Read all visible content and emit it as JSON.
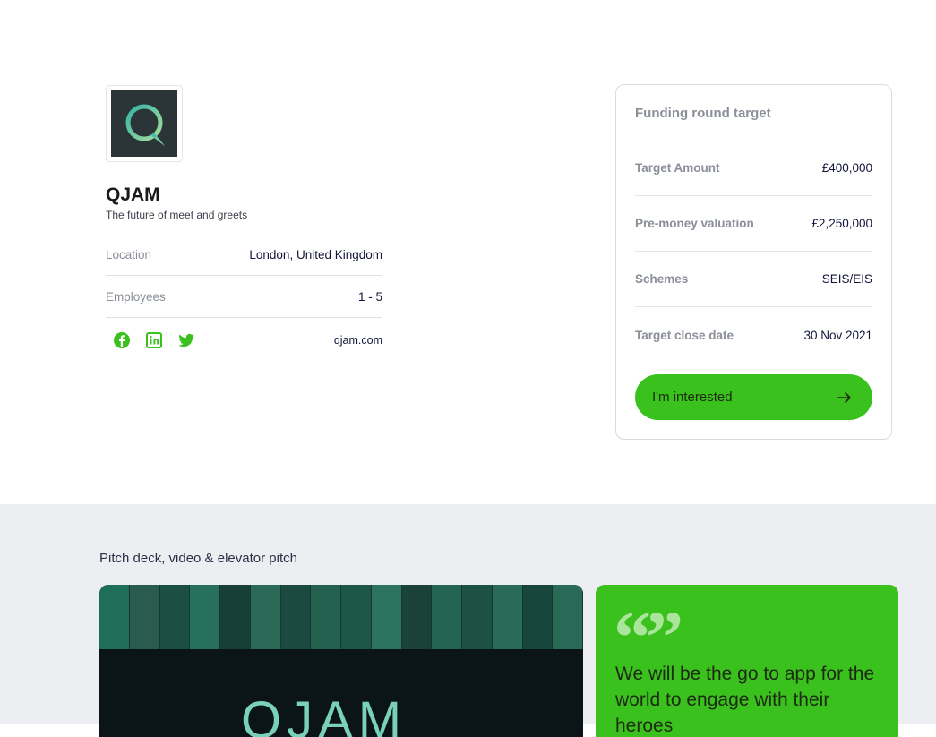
{
  "company": {
    "name": "QJAM",
    "tagline": "The future of meet and greets",
    "logo_letter": "Q",
    "details": [
      {
        "label": "Location",
        "value": "London, United Kingdom"
      },
      {
        "label": "Employees",
        "value": "1 - 5"
      }
    ],
    "social": [
      "facebook-icon",
      "linkedin-icon",
      "twitter-icon"
    ],
    "website": "qjam.com"
  },
  "funding": {
    "title": "Funding round target",
    "rows": [
      {
        "label": "Target Amount",
        "value": "£400,000"
      },
      {
        "label": "Pre-money valuation",
        "value": "£2,250,000"
      },
      {
        "label": "Schemes",
        "value": "SEIS/EIS"
      },
      {
        "label": "Target close date",
        "value": "30 Nov 2021"
      }
    ],
    "cta_label": "I'm interested"
  },
  "pitch": {
    "section_title": "Pitch deck, video & elevator pitch",
    "media_word": "QJAM",
    "quote_mark": "“”",
    "quote": "We will be the go to app for the world to engage with their heroes"
  },
  "colors": {
    "accent": "#3bc11d",
    "logo_bg": "#2b3437",
    "panel_bg": "#edeef2"
  }
}
